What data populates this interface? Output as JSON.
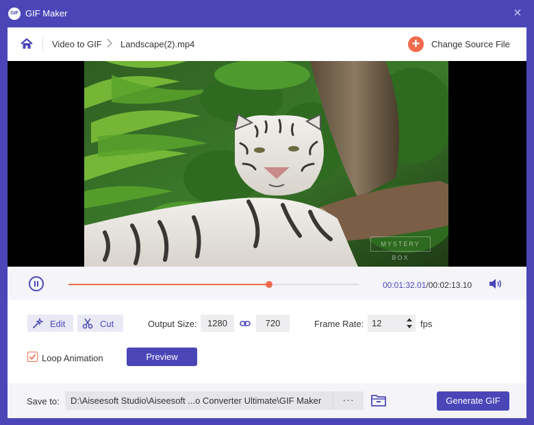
{
  "window": {
    "title": "GIF Maker",
    "logo_text": "GIF",
    "close_glyph": "×"
  },
  "header": {
    "home_icon": "home-icon",
    "breadcrumb": [
      "Video to GIF",
      "Landscape(2).mp4"
    ],
    "change_source": {
      "icon": "plus-icon",
      "label": "Change Source File"
    }
  },
  "video": {
    "watermark": "MYSTERY BOX"
  },
  "playback": {
    "state": "playing",
    "current_time": "00:01:32.01",
    "separator": "/",
    "total_time": "00:02:13.10",
    "progress": 0.69,
    "volume_icon": "volume-icon"
  },
  "tools": {
    "edit_label": "Edit",
    "cut_label": "Cut"
  },
  "output": {
    "size_label": "Output Size:",
    "width": "1280",
    "height": "720",
    "frame_rate_label": "Frame Rate:",
    "frame_rate": "12",
    "fps_unit": "fps"
  },
  "options": {
    "loop_label": "Loop Animation",
    "loop_checked": true,
    "preview_label": "Preview"
  },
  "footer": {
    "save_label": "Save to:",
    "path": "D:\\Aiseesoft Studio\\Aiseesoft ...o Converter Ultimate\\GIF Maker",
    "dots": "···",
    "generate_label": "Generate GIF"
  },
  "colors": {
    "accent": "#4a46b8",
    "highlight": "#ef6b4c"
  }
}
